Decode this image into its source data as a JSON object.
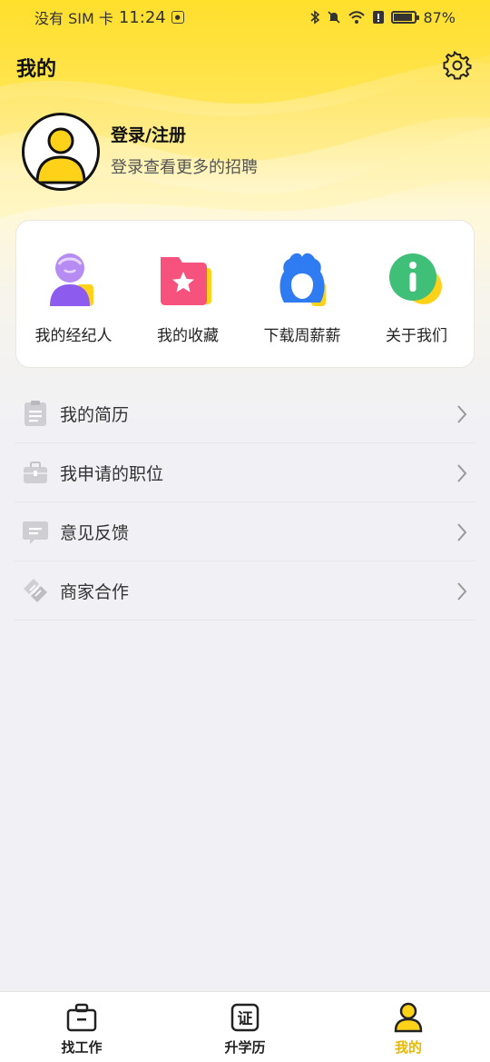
{
  "status_bar": {
    "carrier": "没有 SIM 卡",
    "time": "11:24",
    "battery": "87%",
    "battery_level": 0.87
  },
  "header": {
    "title": "我的"
  },
  "profile": {
    "login_title": "登录/注册",
    "login_subtitle": "登录查看更多的招聘"
  },
  "quick_actions": [
    {
      "label": "我的经纪人",
      "icon": "agent-icon"
    },
    {
      "label": "我的收藏",
      "icon": "favorites-folder-icon"
    },
    {
      "label": "下载周薪薪",
      "icon": "app-download-icon"
    },
    {
      "label": "关于我们",
      "icon": "info-icon"
    }
  ],
  "menu": [
    {
      "label": "我的简历",
      "icon": "clipboard-icon"
    },
    {
      "label": "我申请的职位",
      "icon": "briefcase-icon"
    },
    {
      "label": "意见反馈",
      "icon": "feedback-icon"
    },
    {
      "label": "商家合作",
      "icon": "handshake-icon"
    }
  ],
  "tabbar": [
    {
      "label": "找工作",
      "icon": "briefcase-icon",
      "active": false
    },
    {
      "label": "升学历",
      "icon": "certificate-icon",
      "glyph": "证",
      "active": false
    },
    {
      "label": "我的",
      "icon": "user-icon",
      "active": true
    }
  ],
  "colors": {
    "brand_yellow": "#ffdf2a",
    "active_tab": "#e8b700"
  }
}
